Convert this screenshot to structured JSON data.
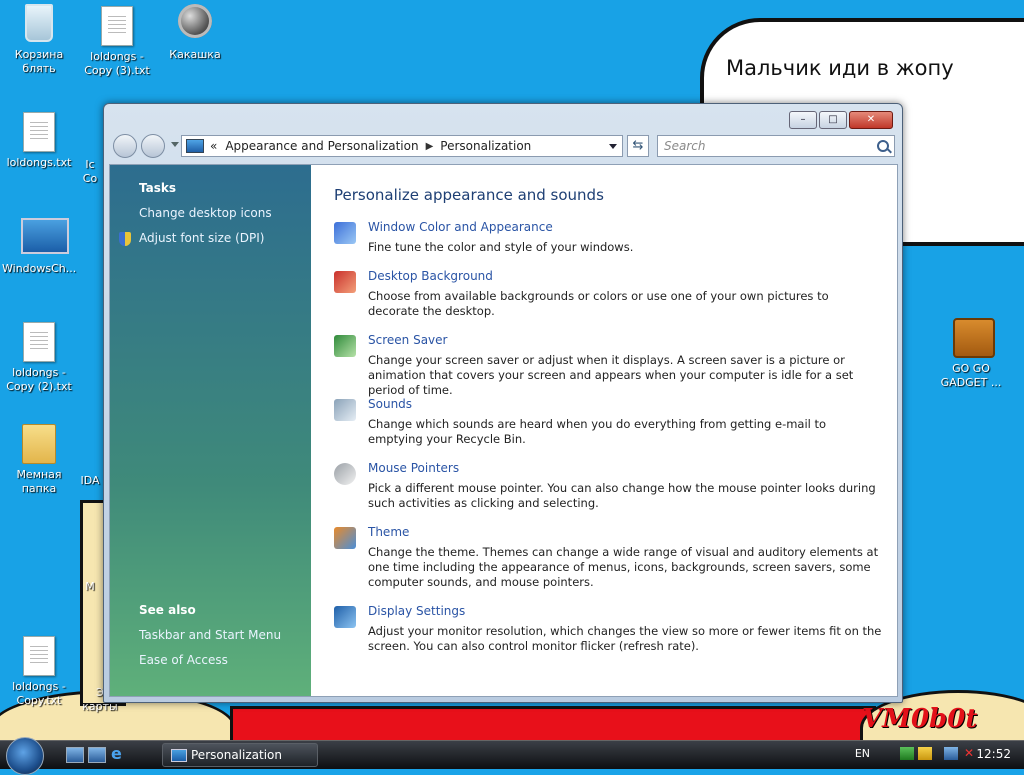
{
  "desktop": {
    "bubble_text": "Мальчик иди в жопу",
    "signature": "VM0b0t",
    "icons": [
      {
        "label1": "Корзина",
        "label2": "блять"
      },
      {
        "label1": "loldongs -",
        "label2": "Copy (3).txt"
      },
      {
        "label1": "Какашка",
        "label2": ""
      },
      {
        "label1": "loldongs.txt",
        "label2": ""
      },
      {
        "label1": "WindowsCh...",
        "label2": ""
      },
      {
        "label1": "loldongs -",
        "label2": "Copy (2).txt"
      },
      {
        "label1": "Мемная",
        "label2": "папка"
      },
      {
        "label1": "loldongs -",
        "label2": "Copy.txt"
      },
      {
        "label1": "GO GO",
        "label2": "GADGET ..."
      },
      {
        "label1": "Ic",
        "label2": "Co"
      },
      {
        "label1": "IDA",
        "label2": ""
      },
      {
        "label1": "M",
        "label2": ""
      },
      {
        "label1": "Э",
        "label2": "карты"
      }
    ]
  },
  "window": {
    "address": {
      "prefix": "«",
      "crumbs": [
        "Appearance and Personalization",
        "Personalization"
      ]
    },
    "search_placeholder": "Search",
    "sidebar": {
      "tasks_heading": "Tasks",
      "tasks": [
        "Change desktop icons",
        "Adjust font size (DPI)"
      ],
      "see_also_heading": "See also",
      "see_also": [
        "Taskbar and Start Menu",
        "Ease of Access"
      ]
    },
    "main": {
      "title": "Personalize appearance and sounds",
      "items": [
        {
          "link": "Window Color and Appearance",
          "desc": "Fine tune the color and style of your windows.",
          "icon": "window-color-icon"
        },
        {
          "link": "Desktop Background",
          "desc": "Choose from available backgrounds or colors or use one of your own pictures to decorate the desktop.",
          "icon": "desktop-background-icon"
        },
        {
          "link": "Screen Saver",
          "desc": "Change your screen saver or adjust when it displays. A screen saver is a picture or animation that covers your screen and appears when your computer is idle for a set period of time.",
          "icon": "screen-saver-icon"
        },
        {
          "link": "Sounds",
          "desc": "Change which sounds are heard when you do everything from getting e-mail to emptying your Recycle Bin.",
          "icon": "sounds-icon"
        },
        {
          "link": "Mouse Pointers",
          "desc": "Pick a different mouse pointer. You can also change how the mouse pointer looks during such activities as clicking and selecting.",
          "icon": "mouse-pointer-icon"
        },
        {
          "link": "Theme",
          "desc": "Change the theme. Themes can change a wide range of visual and auditory elements at one time including the appearance of menus, icons, backgrounds, screen savers, some computer sounds, and mouse pointers.",
          "icon": "theme-icon"
        },
        {
          "link": "Display Settings",
          "desc": "Adjust your monitor resolution, which changes the view so more or fewer items fit on the screen. You can also control monitor flicker (refresh rate).",
          "icon": "display-settings-icon"
        }
      ]
    }
  },
  "taskbar": {
    "task_label": "Personalization",
    "lang": "EN",
    "clock": "12:52"
  }
}
